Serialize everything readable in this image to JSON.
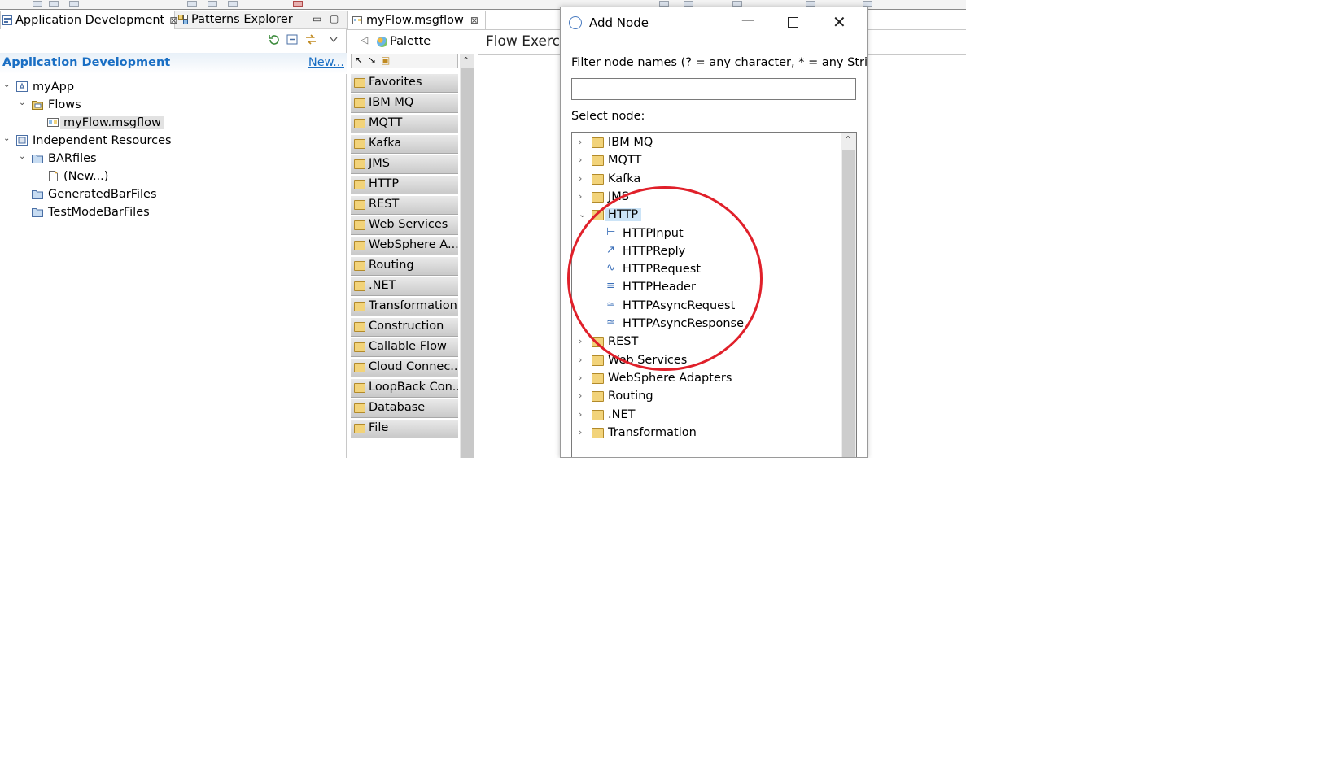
{
  "left_panel": {
    "tabs": [
      {
        "label": "Application Development",
        "close": "⊠"
      },
      {
        "label": "Patterns Explorer"
      }
    ],
    "minimize": "▭",
    "maximize": "▢",
    "header_title": "Application Development",
    "new_link": "New...",
    "tree": [
      {
        "label": "myApp",
        "icon": "application-icon"
      },
      {
        "label": "Flows",
        "icon": "flows-folder-icon"
      },
      {
        "label": "myFlow.msgflow",
        "icon": "msgflow-icon"
      },
      {
        "label": "Independent Resources",
        "icon": "resources-icon"
      },
      {
        "label": "BARfiles",
        "icon": "folder-icon"
      },
      {
        "label": "(New...)",
        "icon": "new-file-icon"
      },
      {
        "label": "GeneratedBarFiles",
        "icon": "folder-icon"
      },
      {
        "label": "TestModeBarFiles",
        "icon": "folder-icon"
      }
    ]
  },
  "editor": {
    "tab_label": "myFlow.msgflow",
    "tab_close": "⊠",
    "palette_label": "Palette",
    "canvas_title": "Flow Exerc",
    "palette_drawers": [
      "Favorites",
      "IBM MQ",
      "MQTT",
      "Kafka",
      "JMS",
      "HTTP",
      "REST",
      "Web Services",
      "WebSphere A...",
      "Routing",
      ".NET",
      "Transformation",
      "Construction",
      "Callable Flow",
      "Cloud Connec...",
      "LoopBack Con...",
      "Database",
      "File"
    ]
  },
  "dialog": {
    "title": "Add Node",
    "minimize": "—",
    "close": "✕",
    "filter_label": "Filter node names (? = any character, * = any String):",
    "filter_value": "",
    "select_label": "Select node:",
    "nodes": [
      {
        "label": "IBM MQ",
        "expanded": false
      },
      {
        "label": "MQTT",
        "expanded": false
      },
      {
        "label": "Kafka",
        "expanded": false
      },
      {
        "label": "JMS",
        "expanded": false
      },
      {
        "label": "HTTP",
        "expanded": true,
        "selected": true
      },
      {
        "label": "HTTPInput",
        "child": true
      },
      {
        "label": "HTTPReply",
        "child": true
      },
      {
        "label": "HTTPRequest",
        "child": true
      },
      {
        "label": "HTTPHeader",
        "child": true
      },
      {
        "label": "HTTPAsyncRequest",
        "child": true
      },
      {
        "label": "HTTPAsyncResponse",
        "child": true
      },
      {
        "label": "REST",
        "expanded": false
      },
      {
        "label": "Web Services",
        "expanded": false
      },
      {
        "label": "WebSphere Adapters",
        "expanded": false
      },
      {
        "label": "Routing",
        "expanded": false
      },
      {
        "label": ".NET",
        "expanded": false
      },
      {
        "label": "Transformation",
        "expanded": false
      }
    ]
  },
  "colors": {
    "annotation_circle": "#e0202a",
    "link": "#1a6fc4",
    "selection": "#cce4f7"
  }
}
